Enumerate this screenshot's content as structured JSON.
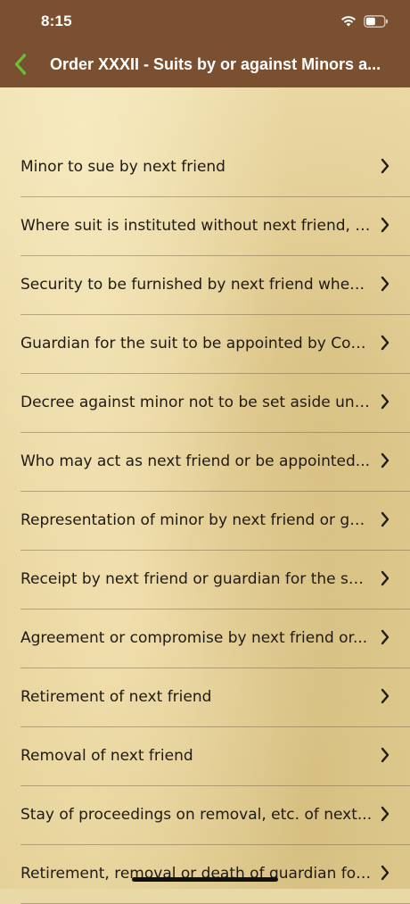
{
  "status_bar": {
    "time": "8:15",
    "icons": [
      "wifi-icon",
      "battery-icon"
    ]
  },
  "nav": {
    "back_icon": "chevron-left-icon",
    "title": "Order XXXII - Suits by or against Minors a..."
  },
  "list": {
    "items": [
      {
        "label": "Minor to sue by next friend"
      },
      {
        "label": "Where suit is instituted without next friend, p..."
      },
      {
        "label": "Security to be furnished by next friend when..."
      },
      {
        "label": "Guardian for the suit to be appointed by Cou..."
      },
      {
        "label": "Decree against minor not to be set aside unl..."
      },
      {
        "label": "Who may act as next friend or be appointed..."
      },
      {
        "label": "Representation of minor by next friend or gu..."
      },
      {
        "label": "Receipt by next friend or guardian for the sui..."
      },
      {
        "label": "Agreement or compromise by next friend or..."
      },
      {
        "label": "Retirement of next friend"
      },
      {
        "label": "Removal of next friend"
      },
      {
        "label": "Stay of proceedings on removal, etc. of next..."
      },
      {
        "label": "Retirement, removal or death of guardian for..."
      }
    ]
  },
  "colors": {
    "header": "#7a5030",
    "accent_back": "#6dbf3a",
    "text": "#1e1a14"
  }
}
